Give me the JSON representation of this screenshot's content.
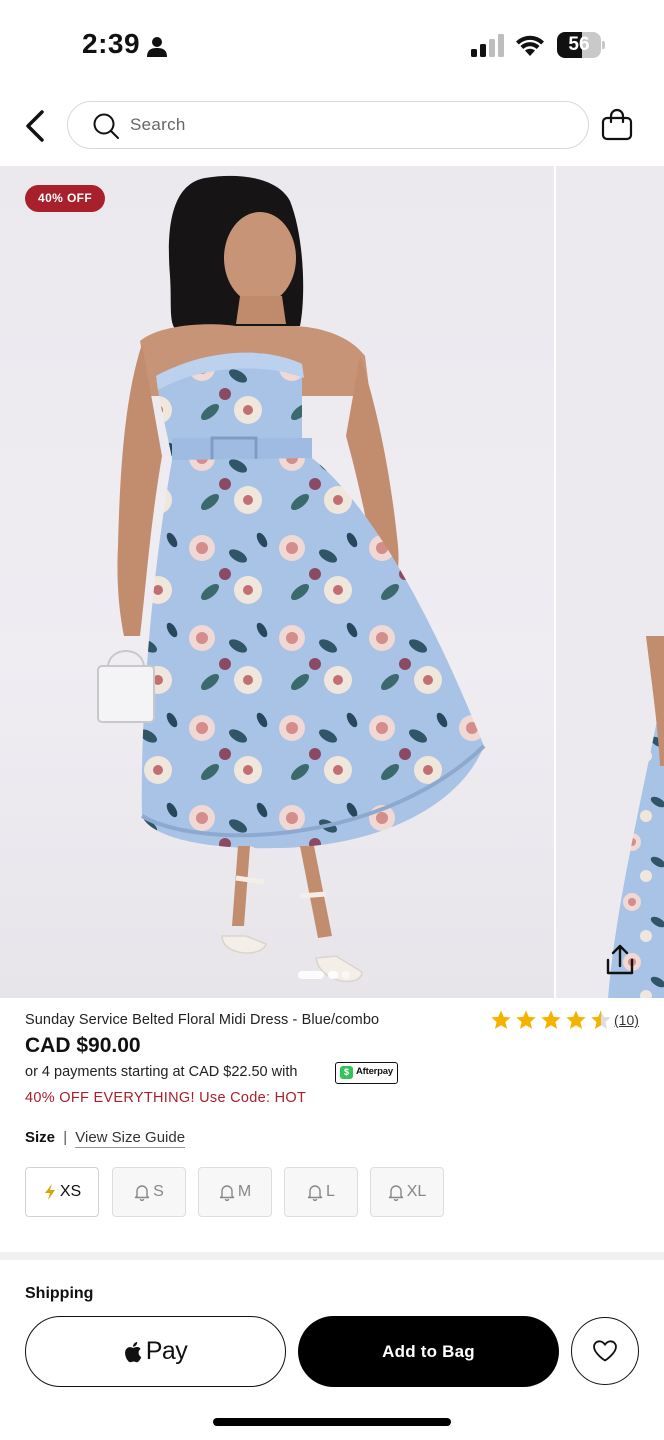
{
  "status_bar": {
    "time": "2:39",
    "battery_level": "56",
    "battery_fraction": 0.56
  },
  "header": {
    "search_placeholder": "Search",
    "icons": [
      "back-arrow-icon",
      "search-icon",
      "shopping-bag-icon"
    ]
  },
  "gallery": {
    "badge": "40% OFF",
    "icons": [
      "share-icon"
    ],
    "slide_count": 2,
    "active_slide": 1
  },
  "product": {
    "name": "Sunday Service Belted Floral Midi Dress - Blue/combo",
    "rating": 4.5,
    "review_count": "(10)",
    "price": "CAD $90.00",
    "installments": "or 4 payments starting at CAD $22.50 with",
    "afterpay_label": "Afterpay",
    "promo": "40% OFF EVERYTHING! Use Code: HOT"
  },
  "size": {
    "label": "Size",
    "separator": "|",
    "guide_link": "View Size Guide",
    "options": [
      {
        "label": "XS",
        "selected": true,
        "icon": "lightning-icon"
      },
      {
        "label": "S",
        "selected": false,
        "icon": "bell-icon"
      },
      {
        "label": "M",
        "selected": false,
        "icon": "bell-icon"
      },
      {
        "label": "L",
        "selected": false,
        "icon": "bell-icon"
      },
      {
        "label": "XL",
        "selected": false,
        "icon": "bell-icon"
      }
    ]
  },
  "shipping": {
    "label": "Shipping"
  },
  "actions": {
    "applepay_label": "Pay",
    "add_to_bag": "Add to Bag",
    "wishlist_icon": "heart-icon"
  },
  "colors": {
    "accent_red": "#a8202b",
    "afterpay_green": "#35c25d",
    "star_gold": "#f5b301",
    "dress_blue": "#a9c3e6"
  }
}
